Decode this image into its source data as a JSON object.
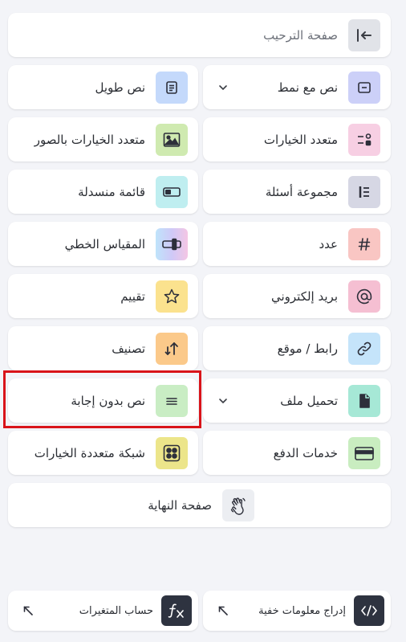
{
  "welcome": {
    "label": "صفحة الترحيب",
    "icon": "collapse-left-icon"
  },
  "items": {
    "styled_text": {
      "label": "نص مع نمط",
      "icon": "text-field-icon",
      "color": "#ccd0f8"
    },
    "long_text": {
      "label": "نص طويل",
      "icon": "document-lines-icon",
      "color": "#c4d9fb"
    },
    "multiple_choice": {
      "label": "متعدد الخيارات",
      "icon": "choice-list-icon",
      "color": "#f7cfe3"
    },
    "image_choice": {
      "label": "متعدد الخيارات بالصور",
      "icon": "image-icon",
      "color": "#cfeab0"
    },
    "question_group": {
      "label": "مجموعة أسئلة",
      "icon": "question-group-icon",
      "color": "#d6d7e4"
    },
    "dropdown": {
      "label": "قائمة منسدلة",
      "icon": "dropdown-toggle-icon",
      "color": "#bfeef0"
    },
    "number": {
      "label": "عدد",
      "icon": "hash-icon",
      "color": "#f9c6c3"
    },
    "linear_scale": {
      "label": "المقياس الخطي",
      "icon": "slider-icon",
      "color": "#c9d6fb"
    },
    "email": {
      "label": "بريد إلكتروني",
      "icon": "at-icon",
      "color": "#f5bfd2"
    },
    "rating": {
      "label": "تقييم",
      "icon": "star-icon",
      "color": "#fbe28e"
    },
    "website": {
      "label": "رابط / موقع",
      "icon": "link-icon",
      "color": "#c5e4fa"
    },
    "ranking": {
      "label": "تصنيف",
      "icon": "sort-arrows-icon",
      "color": "#fbc98a"
    },
    "file_upload": {
      "label": "تحميل ملف",
      "icon": "file-icon",
      "color": "#a6e8d6"
    },
    "statement": {
      "label": "نص بدون إجابة",
      "icon": "equals-icon",
      "color": "#c9edc4"
    },
    "payment": {
      "label": "خدمات الدفع",
      "icon": "credit-card-icon",
      "color": "#c9edc0"
    },
    "choice_grid": {
      "label": "شبكة متعددة الخيارات",
      "icon": "grid-icon",
      "color": "#ece58a"
    }
  },
  "end_page": {
    "label": "صفحة النهاية",
    "icon": "waving-hand-icon"
  },
  "bottom": {
    "hidden_fields": {
      "label": "إدراج معلومات خفية",
      "icon": "code-icon"
    },
    "variables": {
      "label": "حساب المتغيرات",
      "icon": "function-icon"
    }
  }
}
